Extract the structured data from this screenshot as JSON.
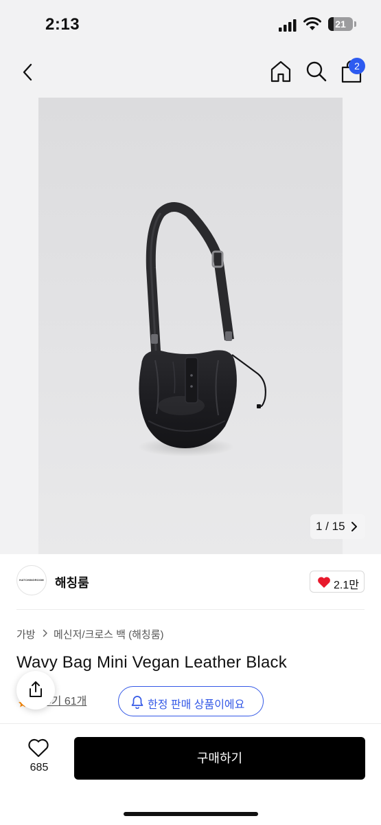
{
  "status_bar": {
    "time": "2:13",
    "battery_percent": "21",
    "battery_level": 0.21
  },
  "nav": {
    "icons": [
      "back-icon",
      "home-icon",
      "search-icon",
      "cart-icon"
    ],
    "cart_badge": "2",
    "badge_color": "#2d5bf0"
  },
  "gallery": {
    "counter": "1 / 15"
  },
  "brand": {
    "logo_text": "HATCHINGROOM",
    "name": "해칭룸",
    "like_count": "2.1만",
    "heart_color": "#e8192c"
  },
  "breadcrumb": {
    "category": "가방",
    "subcategory": "메신저/크로스 백 (해칭룸)"
  },
  "product": {
    "title": "Wavy Bag Mini Vegan Leather Black",
    "review_text": "후기 61개",
    "limited_badge": "한정 판매 상품이에요",
    "accent_color": "#3358e6"
  },
  "bottom_bar": {
    "wish_count": "685",
    "buy_label": "구매하기"
  }
}
